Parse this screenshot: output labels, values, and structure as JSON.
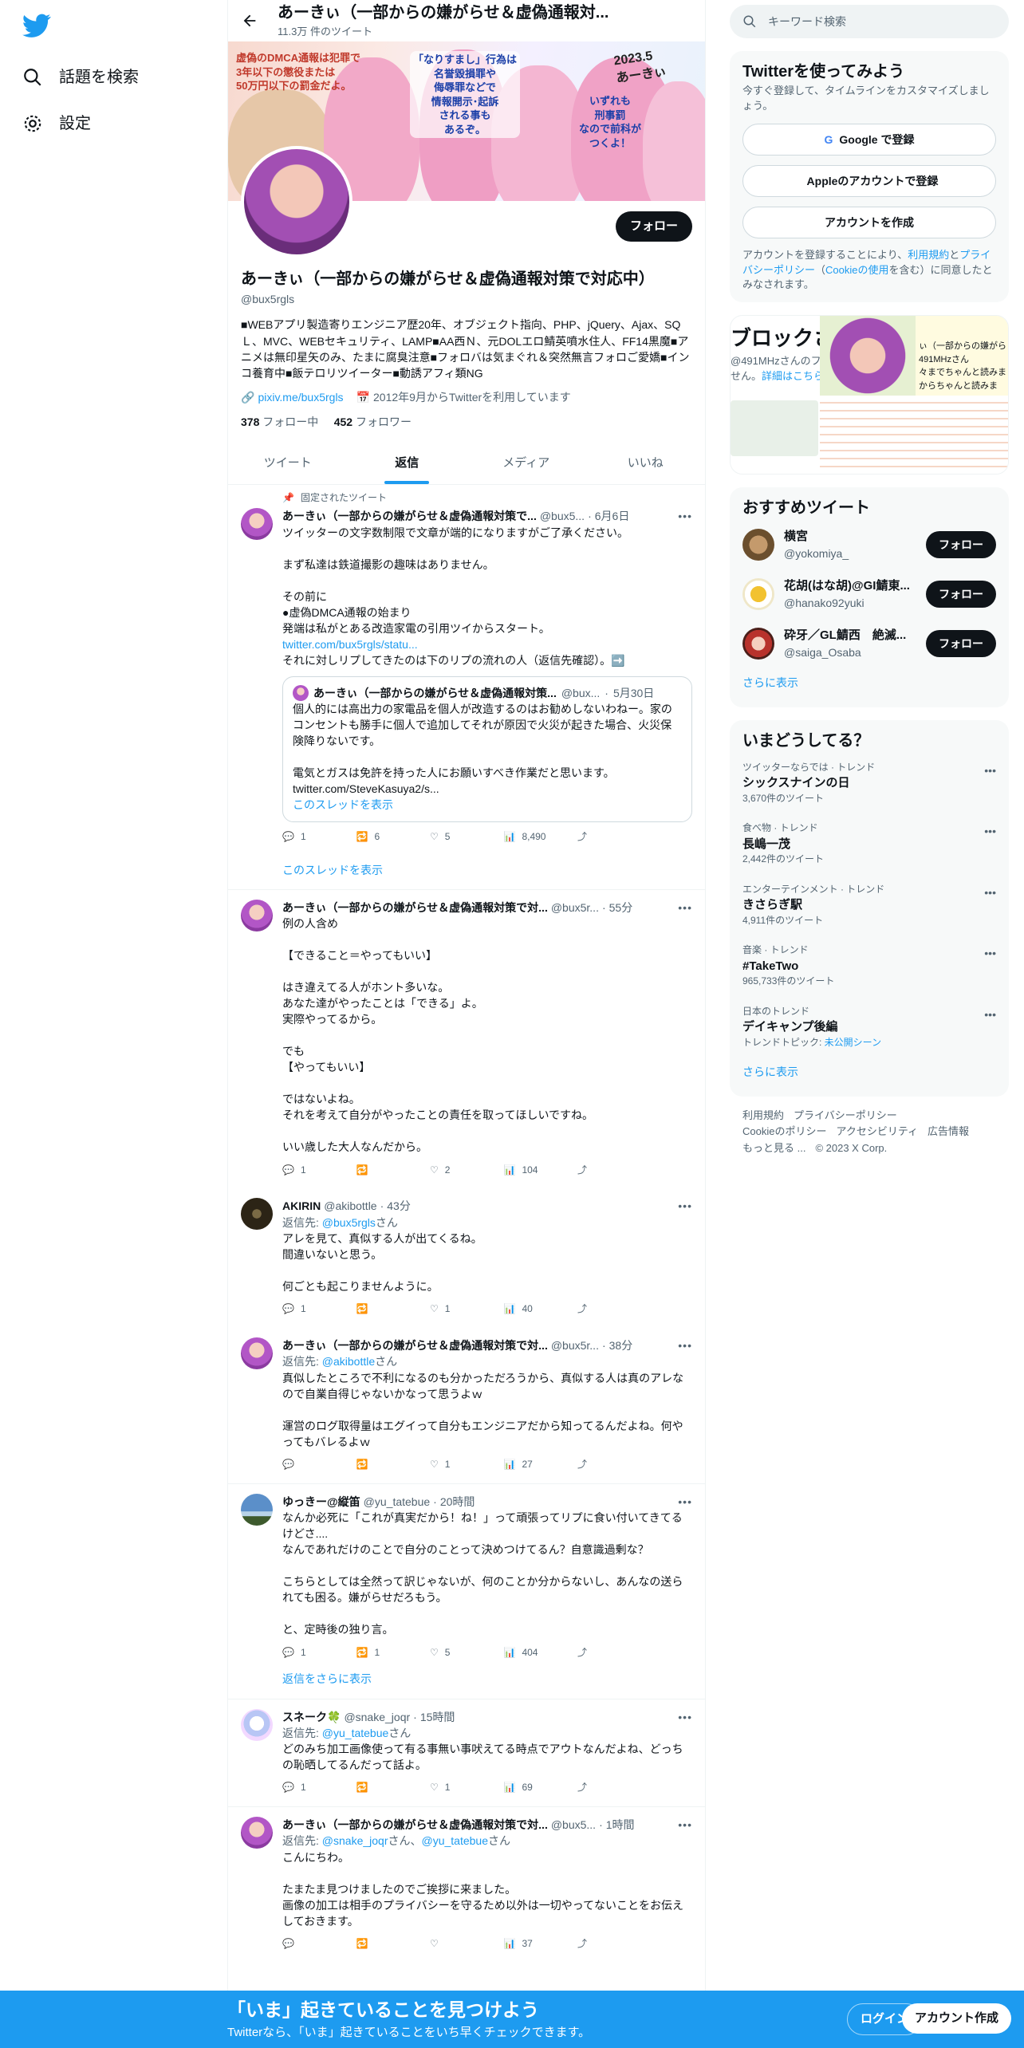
{
  "left_nav": {
    "items": [
      {
        "label": "話題を検索",
        "icon": "search-icon"
      },
      {
        "label": "設定",
        "icon": "gear-icon"
      }
    ]
  },
  "header": {
    "title": "あーきぃ（一部からの嫌がらせ＆虚偽通報対...",
    "subtitle": "11.3万 件のツイート"
  },
  "banner": {
    "caption_left": "虚偽のDMCA通報は犯罪で\n3年以下の懲役または\n50万円以下の罰金だよ。",
    "caption_mid": "「なりすまし」行為は\n名誉毀損罪や\n侮辱罪などで\n情報開示･起訴\nされる事も\nあるぞ。",
    "caption_right": "いずれも\n刑事罰\nなので前科が\nつくよ！",
    "signature": "2023.5\nあーきぃ"
  },
  "profile": {
    "follow_label": "フォロー",
    "name": "あーきぃ（一部からの嫌がらせ＆虚偽通報対策で対応中）",
    "handle": "@bux5rgls",
    "bio": "■WEBアプリ製造寄りエンジニア歴20年、オブジェクト指向、PHP、jQuery、Ajax、SQＬ、MVC、WEBセキュリティ、LAMP■AA西Ｎ、元DOLエロ鯖英噴水住人、FF14黒魔■アニメは無印星矢のみ、たまに腐臭注意■フォロバは気まぐれ＆突然無言フォロご愛嬌■インコ養育中■飯テロリツイーター■動誘アフィ類NG",
    "link": "pixiv.me/bux5rgls",
    "joined": "2012年9月からTwitterを利用しています",
    "following_count": "378",
    "following_label": "フォロー中",
    "followers_count": "452",
    "followers_label": "フォロワー"
  },
  "tabs": [
    "ツイート",
    "返信",
    "メディア",
    "いいね"
  ],
  "pinned_label": "固定されたツイート",
  "tweets": [
    {
      "name": "あーきぃ（一部からの嫌がらせ＆虚偽通報対策で...",
      "handle": "@bux5...",
      "time": "6月6日",
      "text_a": "ツイッターの文字数制限で文章が端的になりますがご了承ください。\n\nまず私達は鉄道撮影の趣味はありません。\n\nその前に\n●虚偽DMCA通報の始まり\n発端は私がとある改造家電の引用ツイからスタート。",
      "link": "twitter.com/bux5rgls/statu...",
      "text_b": "それに対しリプしてきたのは下のリプの流れの人（返信先確認）。➡️",
      "quote_name": "あーきぃ（一部からの嫌がらせ＆虚偽通報対策...",
      "quote_handle": "@bux...",
      "quote_time": "5月30日",
      "quote_text": "個人的には高出力の家電品を個人が改造するのはお勧めしないわねー。家のコンセントも勝手に個人で追加してそれが原因で火災が起きた場合、火災保険降りないです。\n\n電気とガスは免許を持った人にお願いすべき作業だと思います。\ntwitter.com/SteveKasuya2/s...",
      "quote_show": "このスレッドを表示",
      "replies": "1",
      "retweets": "6",
      "likes": "5",
      "views": "8,490",
      "show_thread": "このスレッドを表示"
    },
    {
      "name": "あーきぃ（一部からの嫌がらせ＆虚偽通報対策で対...",
      "handle": "@bux5r...",
      "time": "55分",
      "text": "例の人含め\n\n【できること＝やってもいい】\n\nはき違えてる人がホント多いな。\nあなた達がやったことは「できる」よ。\n実際やってるから。\n\nでも\n【やってもいい】\n\nではないよね。\nそれを考えて自分がやったことの責任を取ってほしいですね。\n\nいい歳した大人なんだから。",
      "replies": "1",
      "retweets": "",
      "likes": "2",
      "views": "104"
    },
    {
      "name": "AKIRIN",
      "handle": "@akibottle",
      "time": "43分",
      "reply_to_label": "返信先: ",
      "reply_to": "@bux5rgls",
      "reply_suffix": "さん",
      "text": "アレを見て、真似する人が出てくるね。\n間違いないと思う。\n\n何ごとも起こりませんように。",
      "replies": "1",
      "retweets": "",
      "likes": "1",
      "views": "40"
    },
    {
      "name": "あーきぃ（一部からの嫌がらせ＆虚偽通報対策で対...",
      "handle": "@bux5r...",
      "time": "38分",
      "reply_to_label": "返信先: ",
      "reply_to": "@akibottle",
      "reply_suffix": "さん",
      "text": "真似したところで不利になるのも分かっただろうから、真似する人は真のアレなので自業自得じゃないかなって思うよｗ\n\n運営のログ取得量はエグイって自分もエンジニアだから知ってるんだよね。何やってもバレるよｗ",
      "replies": "",
      "retweets": "",
      "likes": "1",
      "views": "27"
    },
    {
      "name": "ゆっきー@縦笛",
      "handle": "@yu_tatebue",
      "time": "20時間",
      "text": "なんか必死に「これが真実だから！ね！」って頑張ってリプに食い付いてきてるけどさ....\nなんであれだけのことで自分のことって決めつけてるん？自意識過剰な？\n\nこちらとしては全然って訳じゃないが、何のことか分からないし、あんなの送られても困る。嫌がらせだろもう。\n\nと、定時後の独り言。",
      "replies": "1",
      "retweets": "1",
      "likes": "5",
      "views": "404",
      "more_replies": "返信をさらに表示"
    },
    {
      "name": "スネーク🍀",
      "handle": "@snake_joqr",
      "time": "15時間",
      "reply_to_label": "返信先: ",
      "reply_to": "@yu_tatebue",
      "reply_suffix": "さん",
      "text": "どのみち加工画像使って有る事無い事吠えてる時点でアウトなんだよね、どっちの恥晒してるんだって話よ。",
      "replies": "1",
      "retweets": "",
      "likes": "1",
      "views": "69"
    },
    {
      "name": "あーきぃ（一部からの嫌がらせ＆虚偽通報対策で対...",
      "handle": "@bux5...",
      "time": "1時間",
      "reply_to_label": "返信先: ",
      "reply_to": "@snake_joqr",
      "reply_mid": "さん、",
      "reply_to2": "@yu_tatebue",
      "reply_suffix": "さん",
      "text": "こんにちわ。\n\nたまたま見つけましたのでご挨拶に来ました。\n画像の加工は相手のプライバシーを守るため以外は一切やってないことをお伝えしておきます。",
      "replies": "",
      "retweets": "",
      "likes": "",
      "views": "37"
    }
  ],
  "right": {
    "search_placeholder": "キーワード検索",
    "signup": {
      "title": "Twitterを使ってみよう",
      "subtitle": "今すぐ登録して、タイムラインをカスタマイズしましょう。",
      "google": "Google で登録",
      "apple": "Appleのアカウントで登録",
      "create": "アカウントを作成",
      "terms_a": "アカウントを登録することにより、",
      "terms_link1": "利用規約",
      "terms_b": "と",
      "terms_link2": "プライバシーポリシー",
      "terms_c": "（",
      "terms_link3": "Cookieの使用",
      "terms_d": "を含む）に同意したとみなされます。"
    },
    "block_card": {
      "title": "ブロックさ",
      "sub_a": "@491MHzさんのフ",
      "sub_b": "せん。",
      "link": "詳細はこちら",
      "right_a": "ぃ（一部からの嫌がら",
      "right_b": "491MHzさん",
      "right_c": "々までちゃんと読みま",
      "right_d": "からちゃんと読みま"
    },
    "reco": {
      "title": "おすすめツイート",
      "users": [
        {
          "name": "横宮",
          "handle": "@yokomiya_",
          "btn": "フォロー"
        },
        {
          "name": "花胡(はな胡)@GI鯖東...",
          "handle": "@hanako92yuki",
          "btn": "フォロー"
        },
        {
          "name": "砕牙／GL鯖西　絶滅...",
          "handle": "@saiga_Osaba",
          "btn": "フォロー"
        }
      ],
      "more": "さらに表示"
    },
    "trends": {
      "title": "いまどうしてる？",
      "items": [
        {
          "cat": "ツイッターならでは · トレンド",
          "name": "シックスナインの日",
          "count": "3,670件のツイート"
        },
        {
          "cat": "食べ物 · トレンド",
          "name": "長嶋一茂",
          "count": "2,442件のツイート"
        },
        {
          "cat": "エンターテインメント · トレンド",
          "name": "きさらぎ駅",
          "count": "4,911件のツイート"
        },
        {
          "cat": "音楽 · トレンド",
          "name": "#TakeTwo",
          "count": "965,733件のツイート"
        },
        {
          "cat": "日本のトレンド",
          "name": "デイキャンプ後編",
          "count": "トレンドトピック: ",
          "extra": "未公開シーン"
        }
      ],
      "more": "さらに表示"
    },
    "footer": [
      "利用規約",
      "プライバシーポリシー",
      "Cookieのポリシー",
      "アクセシビリティ",
      "広告情報",
      "もっと見る ...",
      "© 2023 X Corp."
    ]
  },
  "bottom_bar": {
    "big": "「いま」起きていることを見つけよう",
    "small": "Twitterなら、「いま」起きていることをいち早くチェックできます。",
    "login": "ログイン",
    "signup": "アカウント作成"
  },
  "colors": {
    "accent": "#1d9bf0",
    "text": "#0f1419",
    "muted": "#536471"
  }
}
